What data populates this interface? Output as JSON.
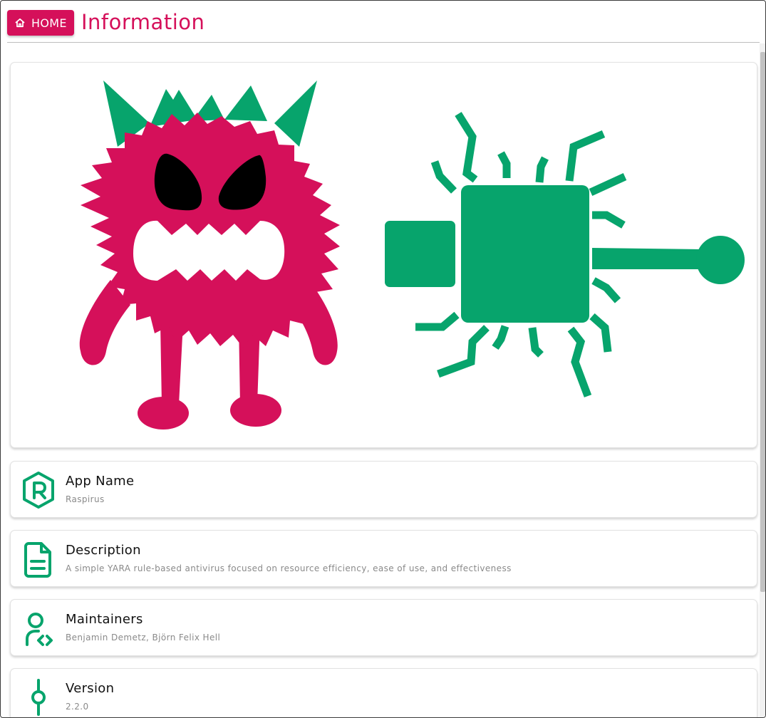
{
  "header": {
    "home_label": "HOME",
    "title": "Information"
  },
  "colors": {
    "accent": "#d5105a",
    "green": "#07a46c"
  },
  "cards": [
    {
      "icon": "app-logo-r-icon",
      "title": "App Name",
      "value": "Raspirus"
    },
    {
      "icon": "document-icon",
      "title": "Description",
      "value": "A simple YARA rule-based antivirus focused on resource efficiency, ease of use, and effectiveness"
    },
    {
      "icon": "user-code-icon",
      "title": "Maintainers",
      "value": "Benjamin Demetz,  Björn Felix Hell"
    },
    {
      "icon": "version-commit-icon",
      "title": "Version",
      "value": "2.2.0"
    }
  ]
}
